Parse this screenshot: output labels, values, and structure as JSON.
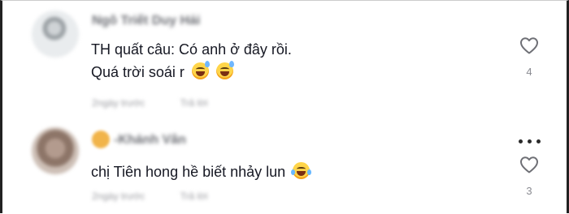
{
  "comments": [
    {
      "username": "Ngô Triết Duy Hải",
      "text_lines": [
        "TH quất câu: Có anh ở đây rồi.",
        "Quá trời soái r"
      ],
      "meta_time": "2ngày trước",
      "meta_reply": "Trả lời",
      "likes": "4"
    },
    {
      "username": "-Khánh Vân",
      "text_lines": [
        "chị Tiên hong hề biết nhảy lun"
      ],
      "meta_time": "2ngày trước",
      "meta_reply": "Trả lời",
      "likes": "3"
    }
  ],
  "icons": {
    "like": "heart-outline-icon",
    "more": "ellipsis-icon",
    "emoji_1": "sweat-smile-emoji",
    "emoji_2": "tears-of-joy-emoji"
  },
  "colors": {
    "text": "#161823",
    "muted": "#8a8b91",
    "background": "#ffffff"
  }
}
